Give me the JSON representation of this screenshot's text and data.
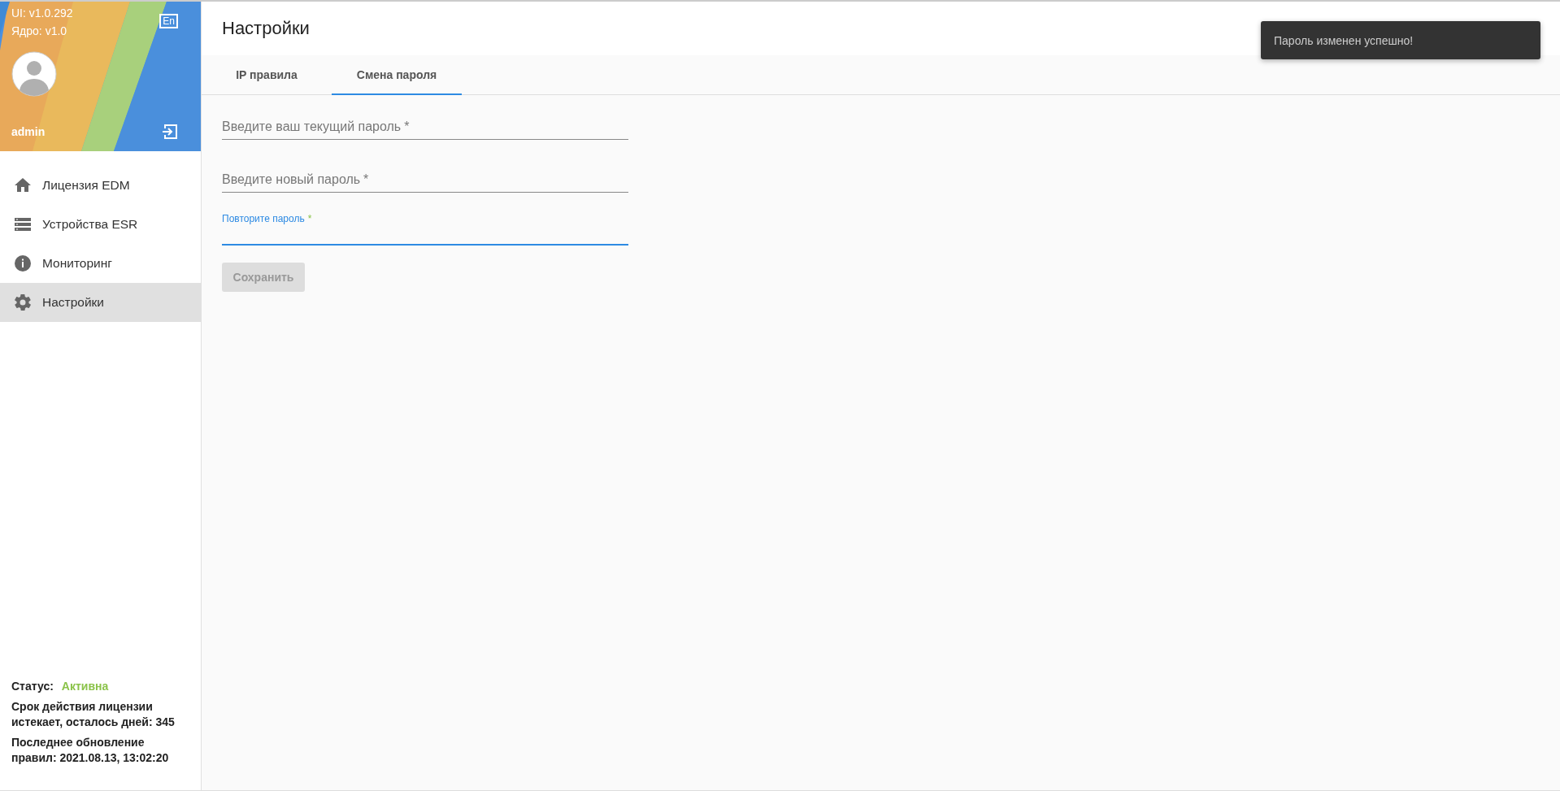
{
  "sidebar": {
    "versions": [
      "UI: v1.0.292",
      "Ядро: v1.0"
    ],
    "language_button": "En",
    "user": {
      "name": "admin"
    },
    "items": [
      {
        "label": "Лицензия EDM",
        "kind": "home",
        "selected": false
      },
      {
        "label": "Устройства ESR",
        "kind": "devices",
        "selected": false
      },
      {
        "label": "Мониторинг",
        "kind": "info",
        "selected": false
      },
      {
        "label": "Настройки",
        "kind": "settings",
        "selected": true
      }
    ],
    "footer": {
      "status_label": "Статус:",
      "status_value": "Активна",
      "license": "Срок действия лицензии истекает, осталось дней: 345",
      "update": "Последнее обновление правил: 2021.08.13, 13:02:20"
    }
  },
  "page": {
    "title": "Настройки",
    "tabs": [
      {
        "label": "IP правила",
        "selected": false
      },
      {
        "label": "Смена пароля",
        "selected": true
      }
    ],
    "fields": [
      {
        "label": "Введите ваш текущий пароль",
        "required": "*",
        "focused": false
      },
      {
        "label": "Введите новый пароль",
        "required": "*",
        "focused": false
      },
      {
        "label": "Повторите пароль",
        "required": "*",
        "focused": true
      }
    ],
    "save_button": {
      "label": "Сохранить",
      "disabled": true
    }
  },
  "toast": {
    "message": "Пароль изменен успешно!"
  }
}
